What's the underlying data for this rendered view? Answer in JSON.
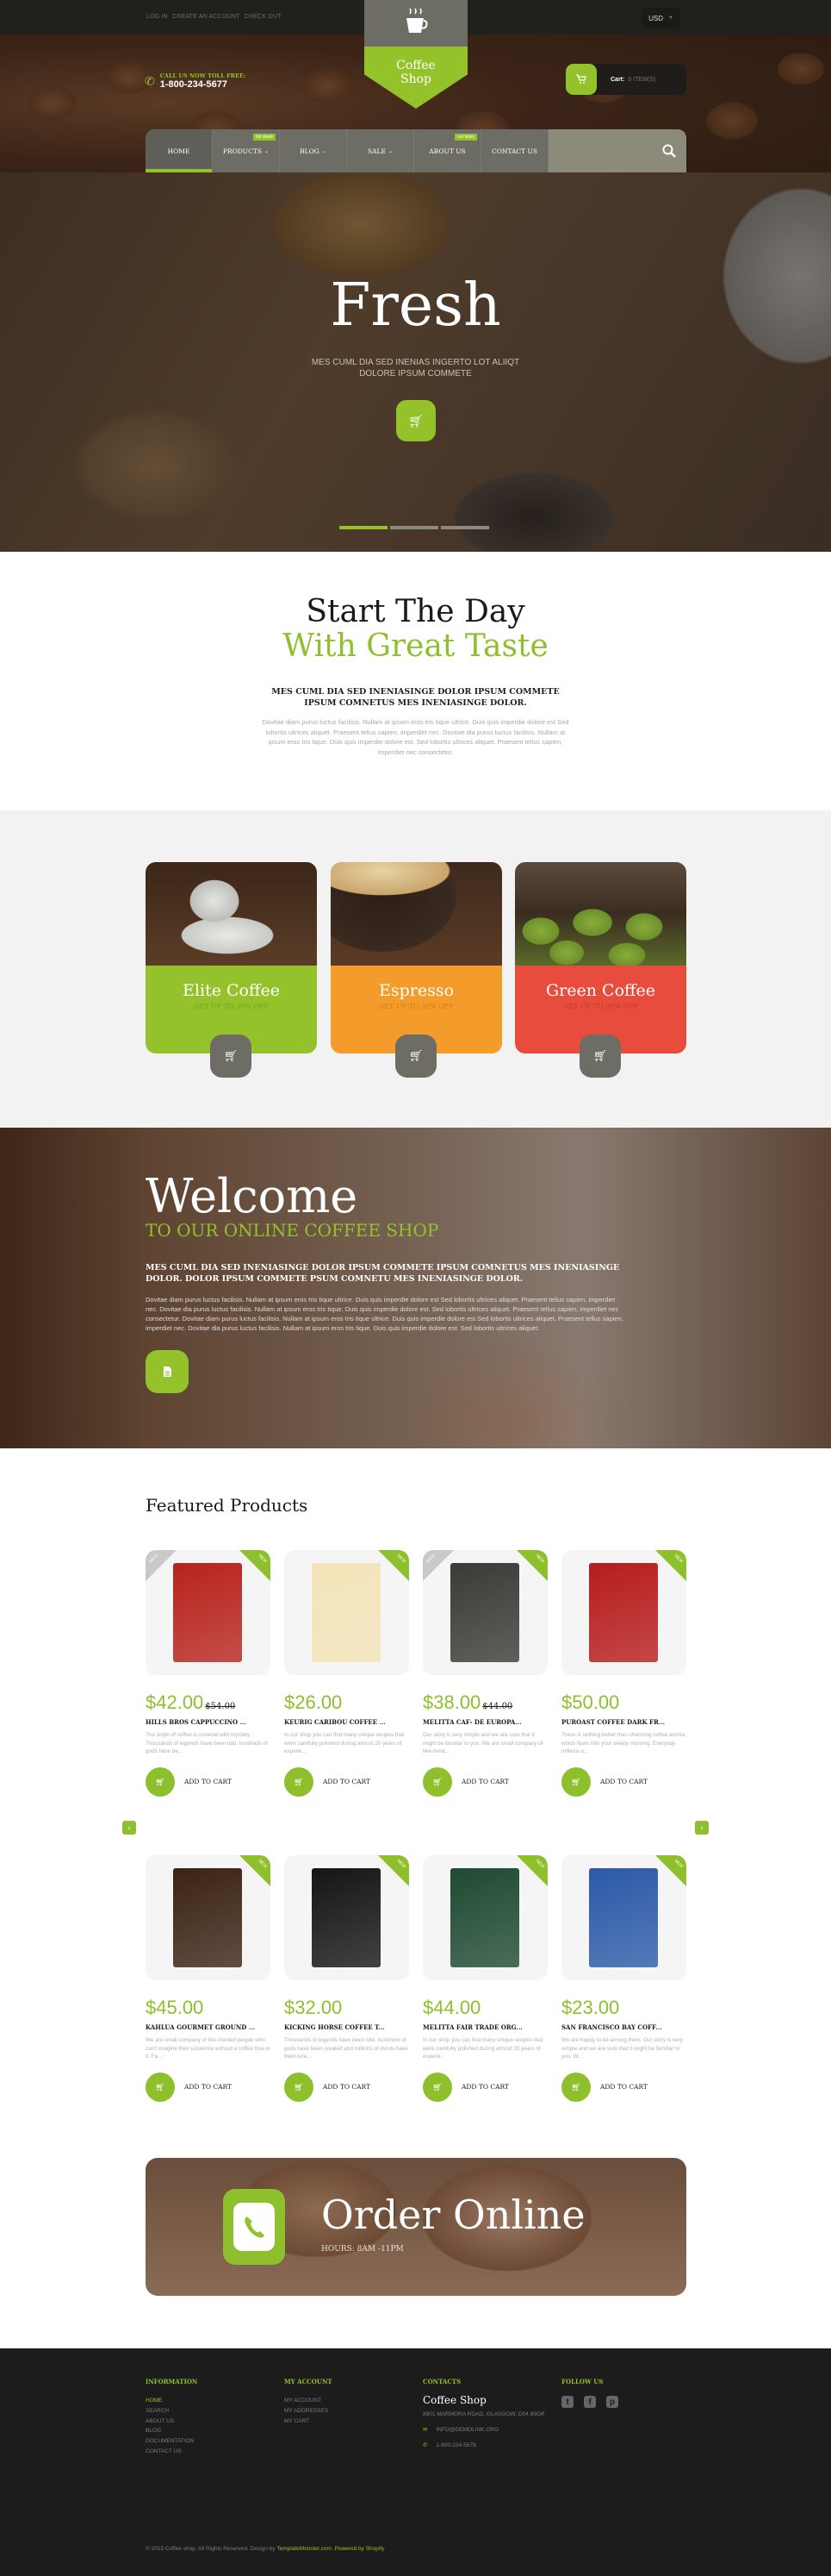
{
  "colors": {
    "accent": "#94c22a",
    "orange": "#f39c2b",
    "red": "#e74c3c",
    "nav_gray": "#6d6c65",
    "dark": "#1c1c1c"
  },
  "topbar": {
    "links": [
      "LOG IN",
      "CREATE AN ACCOUNT",
      "CHECK OUT"
    ],
    "currency": "USD"
  },
  "logo": {
    "line1": "Coffee",
    "line2": "Shop",
    "icon": "coffee-cup-icon"
  },
  "phone": {
    "label": "CALL US NOW TOLL FREE:",
    "number": "1-800-234-5677"
  },
  "cart": {
    "label": "Cart:",
    "count": "0 ITEM(S)"
  },
  "nav": {
    "items": [
      {
        "label": "HOME",
        "active": true
      },
      {
        "label": "PRODUCTS",
        "dropdown": true,
        "badge": "hot deals"
      },
      {
        "label": "BLOG",
        "dropdown": true
      },
      {
        "label": "SALE",
        "dropdown": true
      },
      {
        "label": "ABOUT US",
        "badge": "our team"
      },
      {
        "label": "CONTACT US"
      }
    ],
    "search_icon": "search-icon"
  },
  "hero": {
    "title": "Fresh",
    "subtitle_line1": "MES CUML DIA SED INENIAS INGERTO LOT ALIIQT",
    "subtitle_line2": "DOLORE IPSUM COMMETE",
    "slides": 3,
    "active_slide": 1
  },
  "intro": {
    "title_line1": "Start The Day",
    "title_line2": "With Great Taste",
    "lead": "MES CUML DIA SED INENIASINGE DOLOR IPSUM COMMETE IPSUM COMNETUS MES INENIASINGE DOLOR.",
    "body": "Dovitae diam purus luctus facilisis. Nullam at ipsum eros tris tique ultrice. Duis quis imperdie dolore est Sed lobortis ultrices aliquet. Praesent tellus sapien, imperdiet nec. Dovitae dia purus luctus facilisis. Nullam at ipsum eros tris tique. Duis quis imperdie dolore est. Sed lobortis ultrices aliquet. Praesent tellus sapien, imperdiet nec consectetur."
  },
  "categories": [
    {
      "name": "Elite Coffee",
      "offer": "GET UP TO 30% OFF",
      "color": "#94c22a"
    },
    {
      "name": "Espresso",
      "offer": "GET UP TO 30% OFF",
      "color": "#f39c2b"
    },
    {
      "name": "Green Coffee",
      "offer": "GET UP TO 30% OFF",
      "color": "#e74c3c"
    }
  ],
  "welcome": {
    "title": "Welcome",
    "subtitle": "TO OUR ONLINE COFFEE SHOP",
    "lead": "MES CUML DIA SED INENIASINGE DOLOR IPSUM COMMETE IPSUM COMNETUS MES INENIASINGE DOLOR. DOLOR IPSUM COMMETE PSUM COMNETU MES INENIASINGE DOLOR.",
    "body": "Dovitae diam purus luctus facilisis. Nullam at ipsum eros tris tique ultrice. Duis quis imperdie dolore est Sed lobortis ultrices aliquet. Praesent tellus sapien, imperdiet nec. Dovitae dia purus luctus facilisis. Nullam at ipsum eros tris tique. Duis quis imperdie dolore est. Sed lobortis ultrices aliquet. Praesent tellus sapien, imperdiet nec consectetur. Dovitae diam purus luctus facilisis. Nullam at ipsum eros tris tique ultrice. Duis quis imperdie dolore est Sed lobortis ultrices aliquet. Praesent tellus sapien, imperdiet nec. Dovitae dia purus luctus facilisis. Nullam at ipsum eros tris tique. Duis quis imperdie dolore est. Sed lobortis ultrices aliquet."
  },
  "featured": {
    "title": "Featured Products",
    "add_to_cart": "ADD TO CART",
    "badge_new": "NEW",
    "badge_sale": "SALE",
    "products": [
      {
        "price": "$42.00",
        "old_price": "$54.00",
        "name": "HILLS BROS CAPPUCCINO ...",
        "desc": "The origin of coffee is covered with mystery. Thousands of legends have been told, hundreds of gods have be...",
        "sale": true,
        "new": true,
        "pic_color": "#b8231d"
      },
      {
        "price": "$26.00",
        "old_price": "",
        "name": "KEURIG CARIBOU COFFEE ...",
        "desc": "In our shop you can find many unique recipes that were carefully polished during almost 20 years of experie...",
        "sale": false,
        "new": true,
        "pic_color": "#f3e4b8"
      },
      {
        "price": "$38.00",
        "old_price": "$44.00",
        "name": "MELITTA CAF- DE EUROPA...",
        "desc": "Our story is very simple and we are sure that it might be familiar to you. We are small company of like-mind...",
        "sale": true,
        "new": true,
        "pic_color": "#3a3a36"
      },
      {
        "price": "$50.00",
        "old_price": "",
        "name": "PUROAST COFFEE DARK FR...",
        "desc": "There is nothing better than charming coffee aroma which flows into your sleepy morning. Everyday millions o...",
        "sale": false,
        "new": true,
        "pic_color": "#b71c1c"
      },
      {
        "price": "$45.00",
        "old_price": "",
        "name": "KAHLUA GOURMET GROUND ...",
        "desc": "We are small company of like-minded people who can't imagine their existence without a coffee flow in it. Fa...",
        "sale": false,
        "new": true,
        "pic_color": "#3b2314"
      },
      {
        "price": "$32.00",
        "old_price": "",
        "name": "KICKING HORSE COFFEE T...",
        "desc": "Thousands of legends have been told, hundreds of gods have been created and millions of minds have been lure...",
        "sale": false,
        "new": true,
        "pic_color": "#151515"
      },
      {
        "price": "$44.00",
        "old_price": "",
        "name": "MELITTA FAIR TRADE ORG...",
        "desc": "In our shop you can find many unique recipes that were carefully polished during almost 20 years of experie...",
        "sale": false,
        "new": true,
        "pic_color": "#1f4a32"
      },
      {
        "price": "$23.00",
        "old_price": "",
        "name": "SAN FRANCISCO BAY COFF...",
        "desc": "We are happy to be among them. Our story is very simple and we are sure that it might be familiar to you. W...",
        "sale": false,
        "new": true,
        "pic_color": "#2c5aa8"
      }
    ]
  },
  "order": {
    "title": "Order Online",
    "hours": "HOURS: 8AM -11PM"
  },
  "footer": {
    "information": {
      "heading": "INFORMATION",
      "links": [
        "HOME",
        "SEARCH",
        "ABOUT US",
        "BLOG",
        "DOCUMENTATION",
        "CONTACT US"
      ]
    },
    "account": {
      "heading": "MY ACCOUNT",
      "links": [
        "MY ACCOUNT",
        "MY ADDRESSES",
        "MY CART"
      ]
    },
    "contacts": {
      "heading": "CONTACTS",
      "brand": "Coffee Shop",
      "address": "8901 MARMORA ROAD, GLASGOW, D04 89GR",
      "email": "INFO@DEMOLINK.ORG",
      "phone": "1-800-234-5678"
    },
    "follow": {
      "heading": "FOLLOW US",
      "networks": [
        "twitter",
        "facebook",
        "pinterest"
      ]
    },
    "copyright": "© 2015 Coffee shop. All Rights Reserved. Design by",
    "design_link": "TemplateMonster.com.",
    "powered": "Powered by Shopify"
  }
}
